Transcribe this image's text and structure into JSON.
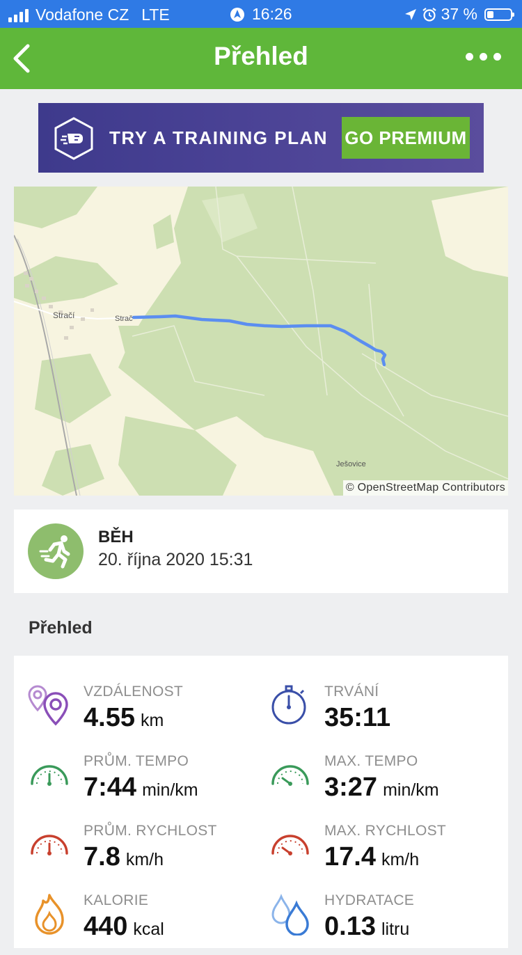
{
  "status_bar": {
    "carrier": "Vodafone CZ",
    "network": "LTE",
    "time": "16:26",
    "battery": "37 %"
  },
  "nav": {
    "title": "Přehled"
  },
  "banner": {
    "text": "TRY A TRAINING PLAN",
    "button": "GO PREMIUM"
  },
  "map": {
    "attribution": "© OpenStreetMap Contributors",
    "places": [
      "Stračí",
      "Strač",
      "Ješovice"
    ]
  },
  "activity": {
    "type": "BĚH",
    "date": "20. října 2020 15:31"
  },
  "overview": {
    "title": "Přehled"
  },
  "stats": [
    {
      "label": "VZDÁLENOST",
      "value": "4.55",
      "unit": "km",
      "icon": "location-pins-icon",
      "color": "#8a4fb8"
    },
    {
      "label": "TRVÁNÍ",
      "value": "35:11",
      "unit": "",
      "icon": "stopwatch-icon",
      "color": "#3a4fa8"
    },
    {
      "label": "PRŮM. TEMPO",
      "value": "7:44",
      "unit": "min/km",
      "icon": "gauge-icon",
      "color": "#3a9a5a"
    },
    {
      "label": "MAX. TEMPO",
      "value": "3:27",
      "unit": "min/km",
      "icon": "gauge-icon",
      "color": "#3a9a5a"
    },
    {
      "label": "PRŮM. RYCHLOST",
      "value": "7.8",
      "unit": "km/h",
      "icon": "gauge-icon",
      "color": "#c8402e"
    },
    {
      "label": "MAX. RYCHLOST",
      "value": "17.4",
      "unit": "km/h",
      "icon": "gauge-icon",
      "color": "#c8402e"
    },
    {
      "label": "KALORIE",
      "value": "440",
      "unit": "kcal",
      "icon": "flame-icon",
      "color": "#e8922a"
    },
    {
      "label": "HYDRATACE",
      "value": "0.13",
      "unit": "litru",
      "icon": "water-drops-icon",
      "color": "#3a7bd5"
    }
  ]
}
